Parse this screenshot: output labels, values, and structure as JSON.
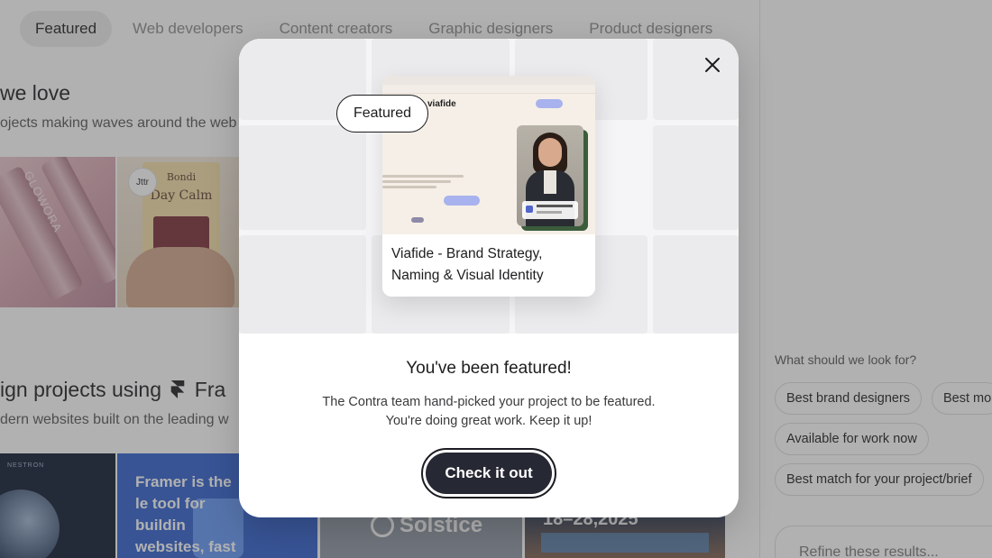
{
  "background": {
    "tabs": [
      {
        "label": "Featured",
        "active": true
      },
      {
        "label": "Web developers"
      },
      {
        "label": "Content creators"
      },
      {
        "label": "Graphic designers"
      },
      {
        "label": "Product designers"
      }
    ],
    "section1": {
      "title": "we love",
      "subtitle": "ojects making waves around the web"
    },
    "section2": {
      "title_prefix": "ign projects using",
      "title_suffix": "Fra",
      "subtitle": "dern websites built on the leading w"
    },
    "tiles": {
      "glowora": "GLOWORA",
      "jttr_badge": "Jttr",
      "bag_brand": "Bondi",
      "bag_name": "Day Calm",
      "nestron": "NESTRON",
      "framer_text": "Framer is the le tool for buildin websites, fast",
      "solstice": "Solstice",
      "date": "18–28,2025"
    },
    "sidebar": {
      "question": "What should we look for?",
      "chips": [
        "Best brand designers",
        "Best mo",
        "Available for work now",
        "Best match for your project/brief"
      ],
      "refine_placeholder": "Refine these results..."
    }
  },
  "modal": {
    "badge": "Featured",
    "project_title": "Viafide - Brand Strategy, Naming & Visual Identity",
    "heading": "You've been featured!",
    "body_line1": "The Contra team hand-picked your project to be featured.",
    "body_line2": "You're doing great work. Keep it up!",
    "cta_label": "Check it out",
    "project_preview_brand": "viafide",
    "icons": {
      "close": "close-icon"
    }
  },
  "colors": {
    "overlay": "#464646",
    "cta_background": "#262833",
    "accent": "#a7b2ee"
  }
}
